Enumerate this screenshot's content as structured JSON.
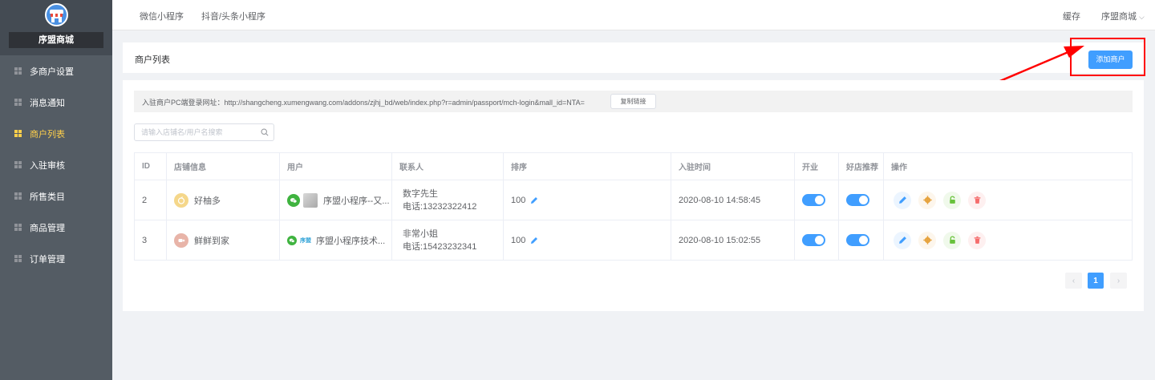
{
  "sidebar": {
    "brand": "序盟商城",
    "items": [
      {
        "label": "多商户设置",
        "active": false
      },
      {
        "label": "消息通知",
        "active": false
      },
      {
        "label": "商户列表",
        "active": true
      },
      {
        "label": "入驻审核",
        "active": false
      },
      {
        "label": "所售类目",
        "active": false
      },
      {
        "label": "商品管理",
        "active": false
      },
      {
        "label": "订单管理",
        "active": false
      }
    ]
  },
  "topbar": {
    "tabs": [
      "微信小程序",
      "抖音/头条小程序"
    ],
    "cache": "缓存",
    "user": "序盟商城"
  },
  "header": {
    "title": "商户列表",
    "add_button": "添加商户"
  },
  "url_bar": {
    "text": "入驻商户PC端登录网址：http://shangcheng.xumengwang.com/addons/zjhj_bd/web/index.php?r=admin/passport/mch-login&mall_id=NTA=",
    "copy_button": "复制链接"
  },
  "search": {
    "placeholder": "请输入店铺名/用户名搜索",
    "value": ""
  },
  "table": {
    "headers": [
      "ID",
      "店铺信息",
      "用户",
      "联系人",
      "排序",
      "入驻时间",
      "开业",
      "好店推荐",
      "操作"
    ],
    "rows": [
      {
        "id": "2",
        "shop": "好柚多",
        "user": "序盟小程序--又...",
        "user_badge": "",
        "contact_name": "数字先生",
        "contact_phone": "电话:13232322412",
        "sort": "100",
        "time": "2020-08-10 14:58:45",
        "open": true,
        "recommend": true
      },
      {
        "id": "3",
        "shop": "鲜鲜到家",
        "user": "序盟小程序技术...",
        "user_badge": "序盟",
        "contact_name": "非常小姐",
        "contact_phone": "电话:15423232341",
        "sort": "100",
        "time": "2020-08-10 15:02:55",
        "open": true,
        "recommend": true
      }
    ]
  },
  "pagination": {
    "prev": "‹",
    "current": "1",
    "next": "›"
  },
  "colors": {
    "primary": "#409eff",
    "sidebar": "#545c64",
    "active_menu": "#ffd04b",
    "annotation": "#ff0000"
  }
}
